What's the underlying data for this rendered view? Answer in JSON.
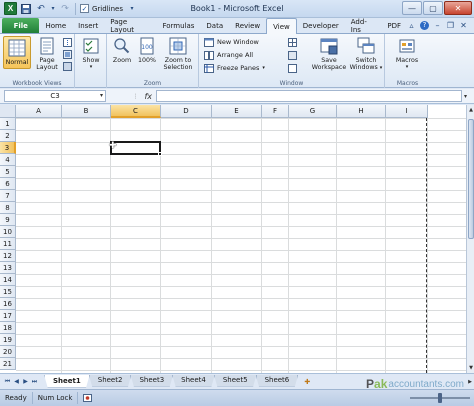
{
  "window": {
    "title": "Book1 - Microsoft Excel",
    "qat_checkbox_label": "Gridlines",
    "controls": {
      "minimize": "—",
      "maximize": "▢",
      "close": "✕"
    }
  },
  "tabs": [
    {
      "label": "File"
    },
    {
      "label": "Home"
    },
    {
      "label": "Insert"
    },
    {
      "label": "Page Layout"
    },
    {
      "label": "Formulas"
    },
    {
      "label": "Data"
    },
    {
      "label": "Review"
    },
    {
      "label": "View",
      "active": true
    },
    {
      "label": "Developer"
    },
    {
      "label": "Add-Ins"
    },
    {
      "label": "PDF"
    }
  ],
  "ribbon": {
    "workbook_views": {
      "label": "Workbook Views",
      "normal": "Normal",
      "page_layout_line1": "Page",
      "page_layout_line2": "Layout"
    },
    "show": {
      "label": "Show"
    },
    "zoom": {
      "label": "Zoom",
      "zoom": "Zoom",
      "hundred": "100%",
      "zoom_sel_line1": "Zoom to",
      "zoom_sel_line2": "Selection"
    },
    "window": {
      "label": "Window",
      "new_window": "New Window",
      "arrange_all": "Arrange All",
      "freeze_panes": "Freeze Panes",
      "save_ws_line1": "Save",
      "save_ws_line2": "Workspace",
      "switch_line1": "Switch",
      "switch_line2": "Windows"
    },
    "macros": {
      "label": "Macros",
      "macros": "Macros"
    }
  },
  "formula_bar": {
    "name_box": "C3",
    "fx": "fx",
    "formula": ""
  },
  "grid": {
    "columns": [
      "A",
      "B",
      "C",
      "D",
      "E",
      "F",
      "G",
      "H",
      "I"
    ],
    "rows": [
      "1",
      "2",
      "3",
      "4",
      "5",
      "6",
      "7",
      "8",
      "9",
      "10",
      "11",
      "12",
      "13",
      "14",
      "15",
      "16",
      "17",
      "18",
      "19",
      "20",
      "21"
    ],
    "active_cell": "C3"
  },
  "sheets": [
    "Sheet1",
    "Sheet2",
    "Sheet3",
    "Sheet4",
    "Sheet5",
    "Sheet6"
  ],
  "status": {
    "ready": "Ready",
    "num_lock": "Num Lock"
  },
  "watermark": {
    "brand_left": "P",
    "brand_mid": "ak",
    "brand_text": "accountants.com"
  },
  "colors": {
    "file_tab": "#1f7f38",
    "selection_header": "#f1c25e",
    "ribbon_bg": "#dde8f5"
  }
}
